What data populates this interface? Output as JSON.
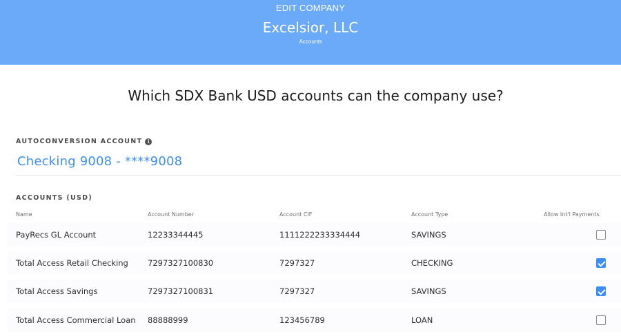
{
  "header": {
    "edit_label": "EDIT COMPANY",
    "company_name": "Excelsior, LLC",
    "subtitle": "Accounts",
    "background_color": "#6aaaf9"
  },
  "question": "Which SDX Bank USD accounts can the company use?",
  "autoconversion": {
    "label": "AUTOCONVERSION ACCOUNT",
    "info_icon": "info-circle-icon",
    "value": "Checking 9008 - ****9008"
  },
  "accounts": {
    "label": "ACCOUNTS (USD)",
    "columns": [
      "Name",
      "Account Number",
      "Account CIF",
      "Account Type",
      "Allow Int'l Payments"
    ],
    "rows": [
      {
        "name": "PayRecs GL Account",
        "number": "12233344445",
        "cif": "1111222233334444",
        "type": "SAVINGS",
        "allow_intl": false
      },
      {
        "name": "Total Access Retail Checking",
        "number": "7297327100830",
        "cif": "7297327",
        "type": "CHECKING",
        "allow_intl": true
      },
      {
        "name": "Total Access Savings",
        "number": "7297327100831",
        "cif": "7297327",
        "type": "SAVINGS",
        "allow_intl": true
      },
      {
        "name": "Total Access Commercial Loan",
        "number": "88888999",
        "cif": "123456789",
        "type": "LOAN",
        "allow_intl": false
      }
    ]
  },
  "colors": {
    "accent": "#3d8ef0",
    "checkbox_checked": "#3b8ff3"
  }
}
